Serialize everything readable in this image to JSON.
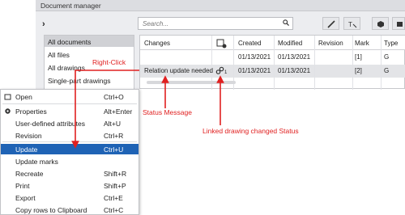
{
  "window": {
    "title": "Document manager"
  },
  "search": {
    "placeholder": "Search..."
  },
  "toolbar": {
    "icons": [
      "pen-icon",
      "text-tool-icon",
      "cube-icon",
      "drawing-view-icon",
      "corner-icon"
    ]
  },
  "nav": {
    "items": [
      "All documents",
      "All files",
      "All drawings",
      "Single-part drawings"
    ]
  },
  "grid": {
    "columns": [
      "Changes",
      "",
      "Created",
      "Modified",
      "Revision",
      "Mark",
      "Type"
    ],
    "rows": [
      {
        "changes": "",
        "linked": "",
        "created": "01/13/2021",
        "modified": "01/13/2021",
        "revision": "",
        "mark": "[1]",
        "type": "G"
      },
      {
        "changes": "Relation update needed",
        "linked": "1",
        "created": "01/13/2021",
        "modified": "01/13/2021",
        "revision": "",
        "mark": "[2]",
        "type": "G"
      }
    ]
  },
  "menu": {
    "items": [
      {
        "label": "Open",
        "shortcut": "Ctrl+O"
      },
      {
        "label": "Properties",
        "shortcut": "Alt+Enter"
      },
      {
        "label": "User-defined attributes",
        "shortcut": "Alt+U"
      },
      {
        "label": "Revision",
        "shortcut": "Ctrl+R"
      },
      {
        "label": "Update",
        "shortcut": "Ctrl+U"
      },
      {
        "label": "Update marks",
        "shortcut": ""
      },
      {
        "label": "Recreate",
        "shortcut": "Shift+R"
      },
      {
        "label": "Print",
        "shortcut": "Shift+P"
      },
      {
        "label": "Export",
        "shortcut": "Ctrl+E"
      },
      {
        "label": "Copy rows to Clipboard",
        "shortcut": "Ctrl+C"
      }
    ],
    "selected_index": 4
  },
  "annotations": {
    "right_click": "Right-Click",
    "status_message": "Status Message",
    "linked_status": "Linked drawing changed Status"
  },
  "colors": {
    "selection": "#1f63b5",
    "annotation": "#e02020",
    "window_bg": "#ecedf0"
  }
}
